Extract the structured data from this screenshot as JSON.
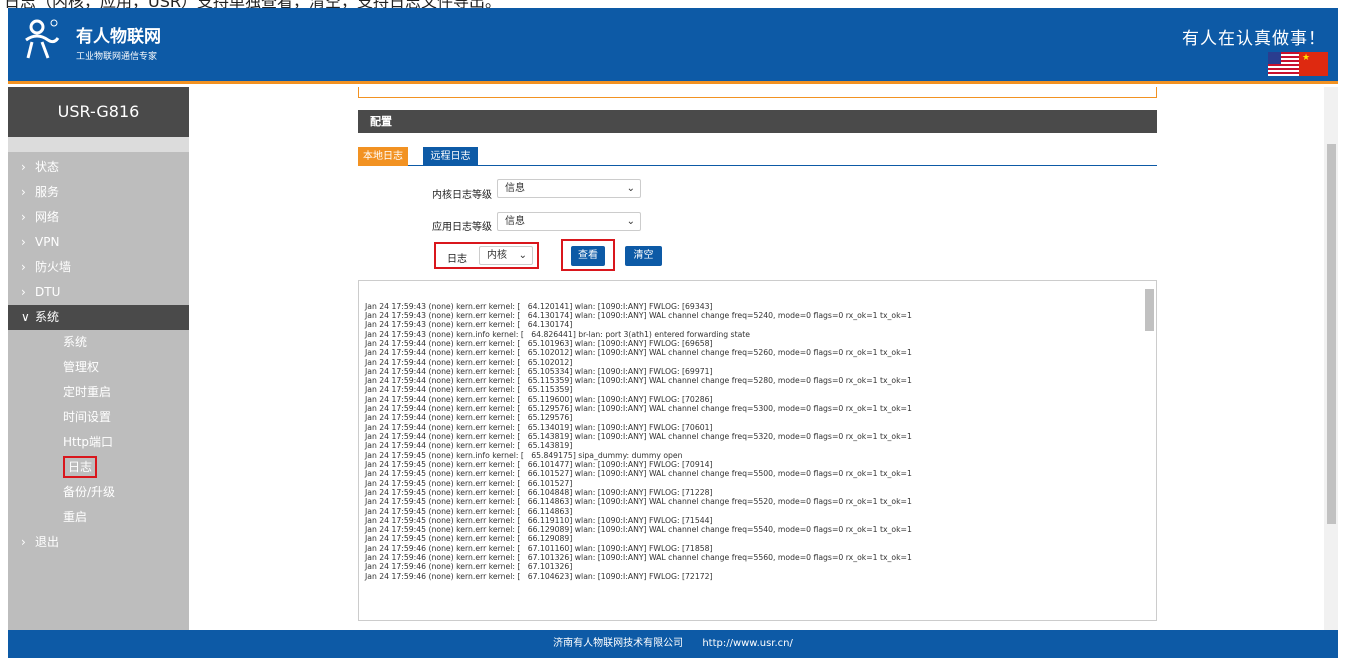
{
  "caption": "日志（内核，应用，USR）支持单独查看，清空，支持日志文件导出。",
  "header": {
    "brand": "有人物联网",
    "brand_sub": "工业物联网通信专家",
    "slogan": "有人在认真做事！",
    "flag_us": "US",
    "flag_cn": "CN"
  },
  "sidebar": {
    "device": "USR-G816",
    "items": [
      {
        "label": "状态",
        "chev": "›"
      },
      {
        "label": "服务",
        "chev": "›"
      },
      {
        "label": "网络",
        "chev": "›"
      },
      {
        "label": "VPN",
        "chev": "›"
      },
      {
        "label": "防火墙",
        "chev": "›"
      },
      {
        "label": "DTU",
        "chev": "›"
      },
      {
        "label": "系统",
        "chev": "∨"
      }
    ],
    "sub_items": [
      "系统",
      "管理权",
      "定时重启",
      "时间设置",
      "Http端口",
      "日志",
      "备份/升级",
      "重启"
    ],
    "exit": {
      "label": "退出",
      "chev": "›"
    }
  },
  "main": {
    "section_title": "配置",
    "tabs": [
      "本地日志",
      "远程日志"
    ],
    "kernel_level_label": "内核日志等级",
    "kernel_level_value": "信息",
    "app_level_label": "应用日志等级",
    "app_level_value": "信息",
    "log_label": "日志",
    "log_type_value": "内核",
    "view_button": "查看",
    "clear_button": "清空",
    "log_text": "Jan 24 17:59:43 (none) kern.err kernel: [   64.120141] wlan: [1090:I:ANY] FWLOG: [69343]\nJan 24 17:59:43 (none) kern.err kernel: [   64.130174] wlan: [1090:I:ANY] WAL channel change freq=5240, mode=0 flags=0 rx_ok=1 tx_ok=1\nJan 24 17:59:43 (none) kern.err kernel: [   64.130174]\nJan 24 17:59:43 (none) kern.info kernel: [   64.826441] br-lan: port 3(ath1) entered forwarding state\nJan 24 17:59:44 (none) kern.err kernel: [   65.101963] wlan: [1090:I:ANY] FWLOG: [69658]\nJan 24 17:59:44 (none) kern.err kernel: [   65.102012] wlan: [1090:I:ANY] WAL channel change freq=5260, mode=0 flags=0 rx_ok=1 tx_ok=1\nJan 24 17:59:44 (none) kern.err kernel: [   65.102012]\nJan 24 17:59:44 (none) kern.err kernel: [   65.105334] wlan: [1090:I:ANY] FWLOG: [69971]\nJan 24 17:59:44 (none) kern.err kernel: [   65.115359] wlan: [1090:I:ANY] WAL channel change freq=5280, mode=0 flags=0 rx_ok=1 tx_ok=1\nJan 24 17:59:44 (none) kern.err kernel: [   65.115359]\nJan 24 17:59:44 (none) kern.err kernel: [   65.119600] wlan: [1090:I:ANY] FWLOG: [70286]\nJan 24 17:59:44 (none) kern.err kernel: [   65.129576] wlan: [1090:I:ANY] WAL channel change freq=5300, mode=0 flags=0 rx_ok=1 tx_ok=1\nJan 24 17:59:44 (none) kern.err kernel: [   65.129576]\nJan 24 17:59:44 (none) kern.err kernel: [   65.134019] wlan: [1090:I:ANY] FWLOG: [70601]\nJan 24 17:59:44 (none) kern.err kernel: [   65.143819] wlan: [1090:I:ANY] WAL channel change freq=5320, mode=0 flags=0 rx_ok=1 tx_ok=1\nJan 24 17:59:44 (none) kern.err kernel: [   65.143819]\nJan 24 17:59:45 (none) kern.info kernel: [   65.849175] sipa_dummy: dummy open\nJan 24 17:59:45 (none) kern.err kernel: [   66.101477] wlan: [1090:I:ANY] FWLOG: [70914]\nJan 24 17:59:45 (none) kern.err kernel: [   66.101527] wlan: [1090:I:ANY] WAL channel change freq=5500, mode=0 flags=0 rx_ok=1 tx_ok=1\nJan 24 17:59:45 (none) kern.err kernel: [   66.101527]\nJan 24 17:59:45 (none) kern.err kernel: [   66.104848] wlan: [1090:I:ANY] FWLOG: [71228]\nJan 24 17:59:45 (none) kern.err kernel: [   66.114863] wlan: [1090:I:ANY] WAL channel change freq=5520, mode=0 flags=0 rx_ok=1 tx_ok=1\nJan 24 17:59:45 (none) kern.err kernel: [   66.114863]\nJan 24 17:59:45 (none) kern.err kernel: [   66.119110] wlan: [1090:I:ANY] FWLOG: [71544]\nJan 24 17:59:45 (none) kern.err kernel: [   66.129089] wlan: [1090:I:ANY] WAL channel change freq=5540, mode=0 flags=0 rx_ok=1 tx_ok=1\nJan 24 17:59:45 (none) kern.err kernel: [   66.129089]\nJan 24 17:59:46 (none) kern.err kernel: [   67.101160] wlan: [1090:I:ANY] FWLOG: [71858]\nJan 24 17:59:46 (none) kern.err kernel: [   67.101326] wlan: [1090:I:ANY] WAL channel change freq=5560, mode=0 flags=0 rx_ok=1 tx_ok=1\nJan 24 17:59:46 (none) kern.err kernel: [   67.101326]\nJan 24 17:59:46 (none) kern.err kernel: [   67.104623] wlan: [1090:I:ANY] FWLOG: [72172]"
  },
  "footer": {
    "company": "济南有人物联网技术有限公司",
    "url": "http://www.usr.cn/"
  },
  "colors": {
    "brand_blue": "#0d5aa6",
    "accent_orange": "#f29222",
    "highlight_red": "#d9161c"
  }
}
